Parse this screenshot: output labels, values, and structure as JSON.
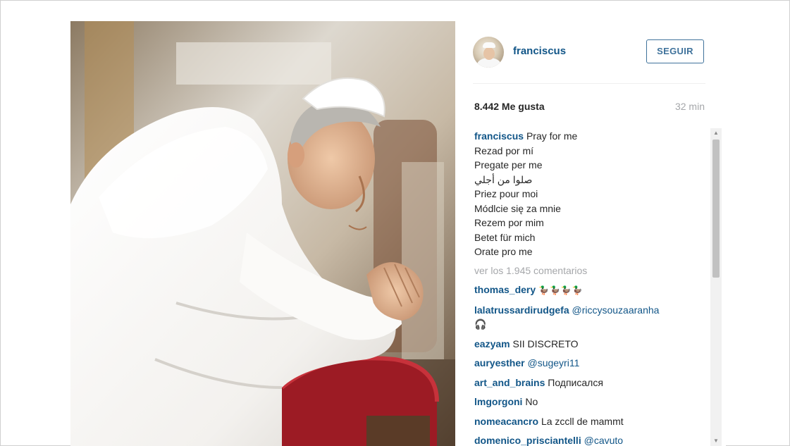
{
  "post": {
    "username": "franciscus",
    "follow_label": "SEGUIR",
    "likes": "8.442 Me gusta",
    "time": "32 min",
    "caption_user": "franciscus",
    "caption_lines": [
      "Pray for me",
      "Rezad por mí",
      "Pregate per me",
      "صلوا من أجلي",
      "Priez pour moi",
      "Módlcie się za mnie",
      "Rezem por mim",
      "Betet für mich",
      "Orate pro me"
    ],
    "view_all_comments": "ver los 1.945 comentarios",
    "comments": [
      {
        "user": "thomas_dery",
        "text": "🦆🦆🦆🦆",
        "type": "emoji"
      },
      {
        "user": "lalatrussardirudgefa",
        "text": "@riccysouzaaranha",
        "type": "mention",
        "extra": "🎧"
      },
      {
        "user": "eazyam",
        "text": "SII DISCRETO",
        "type": "text"
      },
      {
        "user": "auryesther",
        "text": "@sugeyri11",
        "type": "mention"
      },
      {
        "user": "art_and_brains",
        "text": "Подписался",
        "type": "text"
      },
      {
        "user": "lmgorgoni",
        "text": "No",
        "type": "text"
      },
      {
        "user": "nomeacancro",
        "text": "La zccll de mammt",
        "type": "text"
      },
      {
        "user": "domenico_prisciantelli",
        "text": "@cavuto",
        "type": "mention"
      }
    ]
  },
  "icons": {
    "scroll_up": "scroll-up-arrow-icon",
    "scroll_down": "scroll-down-arrow-icon"
  },
  "colors": {
    "username_blue": "#125688",
    "button_border": "#3f729b",
    "muted_gray": "#a5a7aa",
    "text": "#262626"
  }
}
